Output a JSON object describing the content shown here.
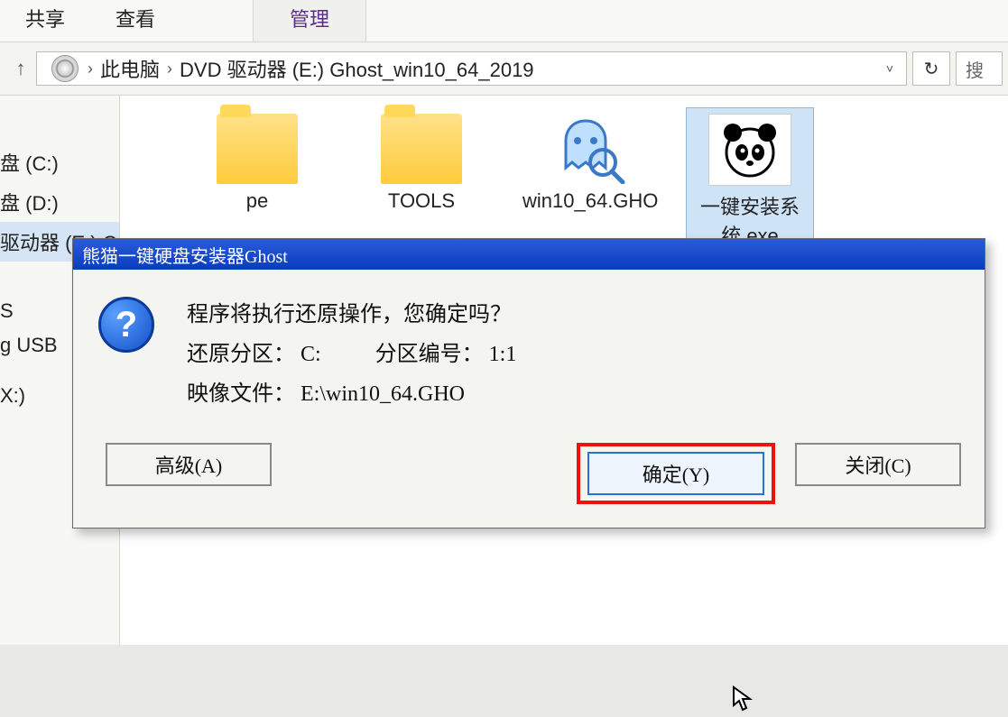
{
  "ribbon": {
    "tabs": {
      "share": "共享",
      "view": "查看",
      "manage": "管理"
    }
  },
  "addressbar": {
    "root": "此电脑",
    "path": "DVD 驱动器 (E:) Ghost_win10_64_2019",
    "search_hint": "搜"
  },
  "sidebar": {
    "items": [
      {
        "label": "盘 (C:)"
      },
      {
        "label": "盘 (D:)"
      },
      {
        "label": "驱动器 (E:) C"
      },
      {
        "label": "S"
      },
      {
        "label": "g USB"
      },
      {
        "label": "X:)"
      }
    ]
  },
  "files": [
    {
      "name": "pe",
      "icon": "folder"
    },
    {
      "name": "TOOLS",
      "icon": "folder"
    },
    {
      "name": "win10_64.GHO",
      "icon": "ghost"
    },
    {
      "name": "一键安装系统.exe",
      "icon": "panda"
    }
  ],
  "dialog": {
    "title": "熊猫一键硬盘安装器Ghost",
    "message": "程序将执行还原操作，您确定吗？",
    "line_partition": "还原分区： C:          分区编号： 1:1",
    "line_image": "映像文件： E:\\win10_64.GHO",
    "buttons": {
      "advanced": "高级(A)",
      "ok": "确定(Y)",
      "close": "关闭(C)"
    }
  }
}
